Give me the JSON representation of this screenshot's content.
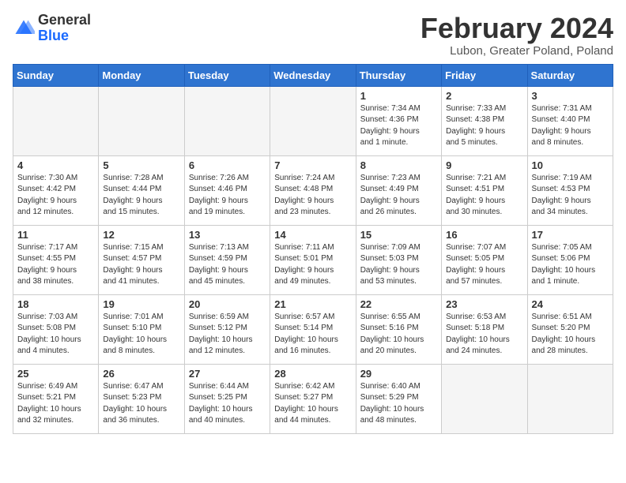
{
  "header": {
    "logo": {
      "line1": "General",
      "line2": "Blue"
    },
    "title": "February 2024",
    "location": "Lubon, Greater Poland, Poland"
  },
  "weekdays": [
    "Sunday",
    "Monday",
    "Tuesday",
    "Wednesday",
    "Thursday",
    "Friday",
    "Saturday"
  ],
  "weeks": [
    [
      {
        "day": "",
        "info": ""
      },
      {
        "day": "",
        "info": ""
      },
      {
        "day": "",
        "info": ""
      },
      {
        "day": "",
        "info": ""
      },
      {
        "day": "1",
        "info": "Sunrise: 7:34 AM\nSunset: 4:36 PM\nDaylight: 9 hours\nand 1 minute."
      },
      {
        "day": "2",
        "info": "Sunrise: 7:33 AM\nSunset: 4:38 PM\nDaylight: 9 hours\nand 5 minutes."
      },
      {
        "day": "3",
        "info": "Sunrise: 7:31 AM\nSunset: 4:40 PM\nDaylight: 9 hours\nand 8 minutes."
      }
    ],
    [
      {
        "day": "4",
        "info": "Sunrise: 7:30 AM\nSunset: 4:42 PM\nDaylight: 9 hours\nand 12 minutes."
      },
      {
        "day": "5",
        "info": "Sunrise: 7:28 AM\nSunset: 4:44 PM\nDaylight: 9 hours\nand 15 minutes."
      },
      {
        "day": "6",
        "info": "Sunrise: 7:26 AM\nSunset: 4:46 PM\nDaylight: 9 hours\nand 19 minutes."
      },
      {
        "day": "7",
        "info": "Sunrise: 7:24 AM\nSunset: 4:48 PM\nDaylight: 9 hours\nand 23 minutes."
      },
      {
        "day": "8",
        "info": "Sunrise: 7:23 AM\nSunset: 4:49 PM\nDaylight: 9 hours\nand 26 minutes."
      },
      {
        "day": "9",
        "info": "Sunrise: 7:21 AM\nSunset: 4:51 PM\nDaylight: 9 hours\nand 30 minutes."
      },
      {
        "day": "10",
        "info": "Sunrise: 7:19 AM\nSunset: 4:53 PM\nDaylight: 9 hours\nand 34 minutes."
      }
    ],
    [
      {
        "day": "11",
        "info": "Sunrise: 7:17 AM\nSunset: 4:55 PM\nDaylight: 9 hours\nand 38 minutes."
      },
      {
        "day": "12",
        "info": "Sunrise: 7:15 AM\nSunset: 4:57 PM\nDaylight: 9 hours\nand 41 minutes."
      },
      {
        "day": "13",
        "info": "Sunrise: 7:13 AM\nSunset: 4:59 PM\nDaylight: 9 hours\nand 45 minutes."
      },
      {
        "day": "14",
        "info": "Sunrise: 7:11 AM\nSunset: 5:01 PM\nDaylight: 9 hours\nand 49 minutes."
      },
      {
        "day": "15",
        "info": "Sunrise: 7:09 AM\nSunset: 5:03 PM\nDaylight: 9 hours\nand 53 minutes."
      },
      {
        "day": "16",
        "info": "Sunrise: 7:07 AM\nSunset: 5:05 PM\nDaylight: 9 hours\nand 57 minutes."
      },
      {
        "day": "17",
        "info": "Sunrise: 7:05 AM\nSunset: 5:06 PM\nDaylight: 10 hours\nand 1 minute."
      }
    ],
    [
      {
        "day": "18",
        "info": "Sunrise: 7:03 AM\nSunset: 5:08 PM\nDaylight: 10 hours\nand 4 minutes."
      },
      {
        "day": "19",
        "info": "Sunrise: 7:01 AM\nSunset: 5:10 PM\nDaylight: 10 hours\nand 8 minutes."
      },
      {
        "day": "20",
        "info": "Sunrise: 6:59 AM\nSunset: 5:12 PM\nDaylight: 10 hours\nand 12 minutes."
      },
      {
        "day": "21",
        "info": "Sunrise: 6:57 AM\nSunset: 5:14 PM\nDaylight: 10 hours\nand 16 minutes."
      },
      {
        "day": "22",
        "info": "Sunrise: 6:55 AM\nSunset: 5:16 PM\nDaylight: 10 hours\nand 20 minutes."
      },
      {
        "day": "23",
        "info": "Sunrise: 6:53 AM\nSunset: 5:18 PM\nDaylight: 10 hours\nand 24 minutes."
      },
      {
        "day": "24",
        "info": "Sunrise: 6:51 AM\nSunset: 5:20 PM\nDaylight: 10 hours\nand 28 minutes."
      }
    ],
    [
      {
        "day": "25",
        "info": "Sunrise: 6:49 AM\nSunset: 5:21 PM\nDaylight: 10 hours\nand 32 minutes."
      },
      {
        "day": "26",
        "info": "Sunrise: 6:47 AM\nSunset: 5:23 PM\nDaylight: 10 hours\nand 36 minutes."
      },
      {
        "day": "27",
        "info": "Sunrise: 6:44 AM\nSunset: 5:25 PM\nDaylight: 10 hours\nand 40 minutes."
      },
      {
        "day": "28",
        "info": "Sunrise: 6:42 AM\nSunset: 5:27 PM\nDaylight: 10 hours\nand 44 minutes."
      },
      {
        "day": "29",
        "info": "Sunrise: 6:40 AM\nSunset: 5:29 PM\nDaylight: 10 hours\nand 48 minutes."
      },
      {
        "day": "",
        "info": ""
      },
      {
        "day": "",
        "info": ""
      }
    ]
  ]
}
